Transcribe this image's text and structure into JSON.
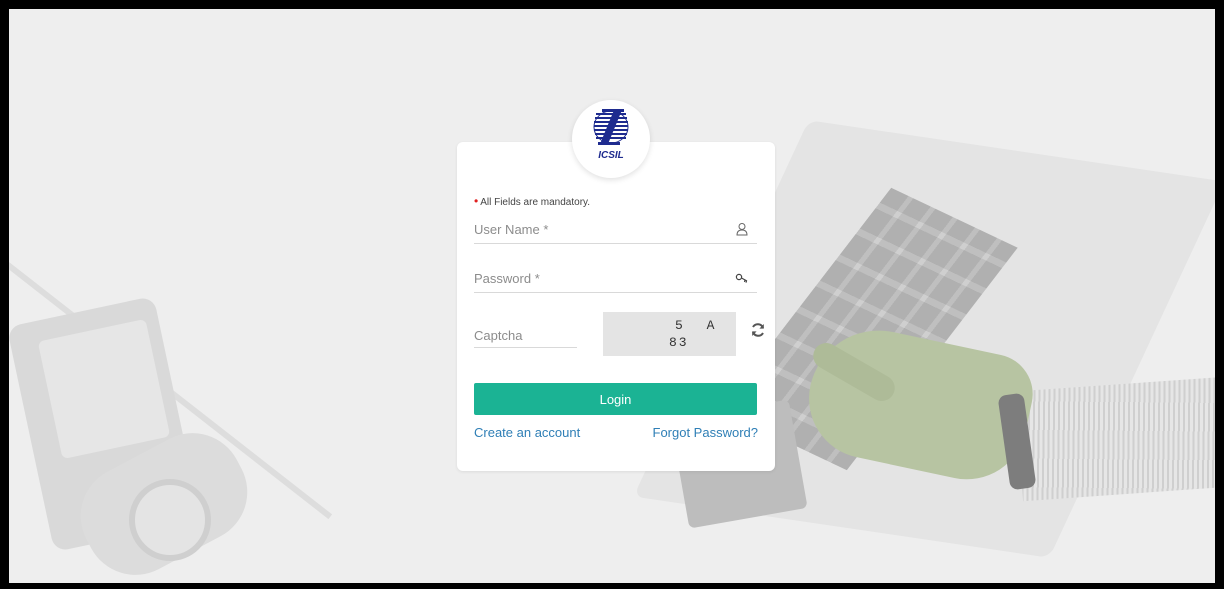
{
  "brand": {
    "logo_text": "ICSIL"
  },
  "form": {
    "mandatory_note": "All Fields are mandatory.",
    "username_placeholder": "User Name *",
    "password_placeholder": "Password *",
    "captcha_placeholder": "Captcha",
    "captcha_line1": "5 A",
    "captcha_line2": "83",
    "login_label": "Login",
    "create_account_label": "Create an account",
    "forgot_password_label": "Forgot Password?"
  },
  "icons": {
    "username": "user-icon",
    "password": "key-icon",
    "refresh": "refresh-icon"
  },
  "colors": {
    "primary_button": "#1bb394",
    "link": "#2f7fb6",
    "required_dot": "#e02020",
    "logo_blue": "#1e2b8f"
  }
}
